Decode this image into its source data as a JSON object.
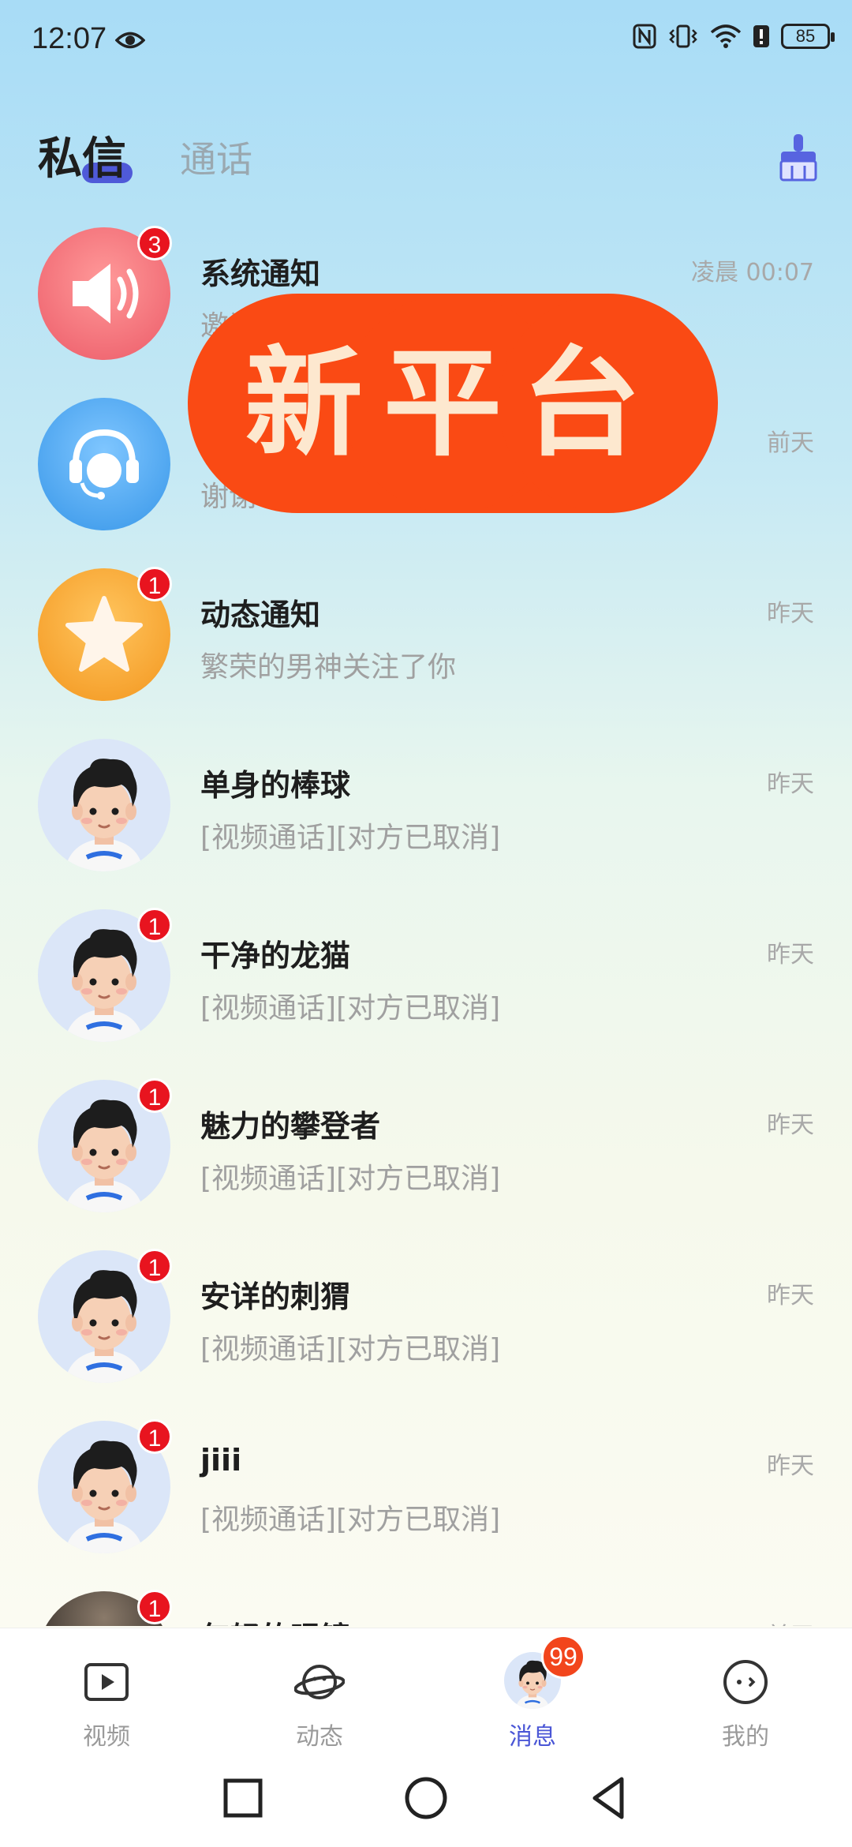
{
  "status_bar": {
    "time": "12:07",
    "battery": "85"
  },
  "header": {
    "tabs": [
      {
        "label": "私信",
        "active": true
      },
      {
        "label": "通话",
        "active": false
      }
    ]
  },
  "promo": {
    "text": "新平台"
  },
  "conversations": [
    {
      "name": "系统通知",
      "preview": "邀请",
      "time": "凌晨 00:07",
      "badge": "3",
      "avatar": "speaker-icon"
    },
    {
      "name": "",
      "preview": "谢谢",
      "time": "前天",
      "badge": "",
      "avatar": "customer-service-icon"
    },
    {
      "name": "动态通知",
      "preview": "繁荣的男神关注了你",
      "time": "昨天",
      "badge": "1",
      "avatar": "star-icon"
    },
    {
      "name": "单身的棒球",
      "preview": "[视频通话][对方已取消]",
      "time": "昨天",
      "badge": "",
      "avatar": "user-avatar"
    },
    {
      "name": "干净的龙猫",
      "preview": "[视频通话][对方已取消]",
      "time": "昨天",
      "badge": "1",
      "avatar": "user-avatar"
    },
    {
      "name": "魅力的攀登者",
      "preview": "[视频通话][对方已取消]",
      "time": "昨天",
      "badge": "1",
      "avatar": "user-avatar"
    },
    {
      "name": "安详的刺猬",
      "preview": "[视频通话][对方已取消]",
      "time": "昨天",
      "badge": "1",
      "avatar": "user-avatar"
    },
    {
      "name": "jiii",
      "preview": "[视频通话][对方已取消]",
      "time": "昨天",
      "badge": "1",
      "avatar": "user-avatar"
    },
    {
      "name": "年轻的眼镜",
      "preview": "",
      "time": "前天",
      "badge": "1",
      "avatar": "photo-avatar"
    }
  ],
  "bottom_nav": [
    {
      "label": "视频",
      "icon": "video-play-icon",
      "active": false
    },
    {
      "label": "动态",
      "icon": "planet-icon",
      "active": false
    },
    {
      "label": "消息",
      "icon": "avatar-icon",
      "active": true,
      "badge": "99"
    },
    {
      "label": "我的",
      "icon": "face-icon",
      "active": false
    }
  ],
  "colors": {
    "accent": "#4a56d6",
    "badge": "#e8141f",
    "promo": "#fa4a14"
  }
}
